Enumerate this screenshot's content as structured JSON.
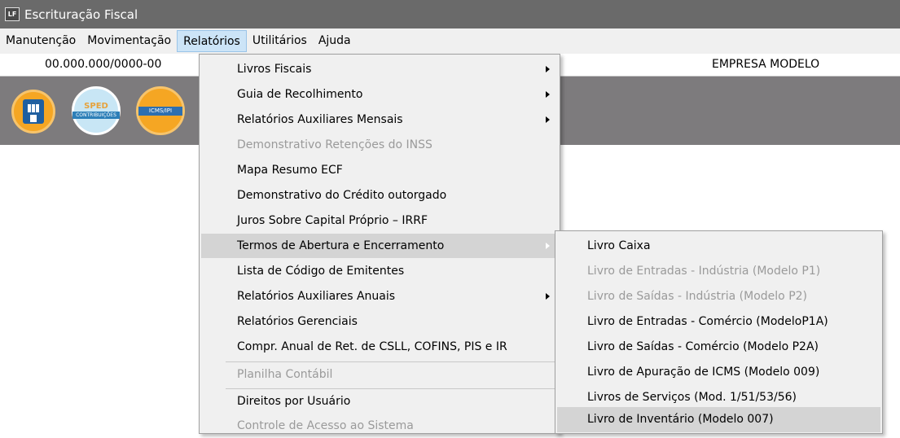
{
  "window": {
    "title": "Escrituração Fiscal",
    "icon_label": "LF"
  },
  "menubar": [
    "Manutenção",
    "Movimentação",
    "Relatórios",
    "Utilitários",
    "Ajuda"
  ],
  "info": {
    "cnpj": "00.000.000/0000-00",
    "company": "EMPRESA MODELO"
  },
  "toolbar": {
    "sped_top": "SPED",
    "sped_band": "CONTRIBUIÇÕES",
    "icms_band": "ICMS/IPI"
  },
  "relatorios_menu": [
    {
      "label": "Livros Fiscais",
      "submenu": true,
      "enabled": true
    },
    {
      "label": "Guia de Recolhimento",
      "submenu": true,
      "enabled": true
    },
    {
      "label": "Relatórios Auxiliares Mensais",
      "submenu": true,
      "enabled": true
    },
    {
      "label": "Demonstrativo Retenções do INSS",
      "submenu": false,
      "enabled": false
    },
    {
      "label": "Mapa Resumo ECF",
      "submenu": false,
      "enabled": true
    },
    {
      "label": "Demonstrativo do Crédito outorgado",
      "submenu": false,
      "enabled": true
    },
    {
      "label": "Juros Sobre Capital Próprio – IRRF",
      "submenu": false,
      "enabled": true
    },
    {
      "label": "Termos de Abertura e Encerramento",
      "submenu": true,
      "enabled": true,
      "highlighted": true
    },
    {
      "label": "Lista de Código de Emitentes",
      "submenu": false,
      "enabled": true
    },
    {
      "label": "Relatórios Auxiliares Anuais",
      "submenu": true,
      "enabled": true
    },
    {
      "label": "Relatórios Gerenciais",
      "submenu": false,
      "enabled": true
    },
    {
      "label": "Compr. Anual de Ret. de CSLL, COFINS,  PIS e IR",
      "submenu": false,
      "enabled": true
    },
    {
      "label": "Planilha Contábil",
      "submenu": false,
      "enabled": false
    },
    {
      "label": "Direitos por Usuário",
      "submenu": false,
      "enabled": true
    },
    {
      "label": "Controle de Acesso ao Sistema",
      "submenu": false,
      "enabled": false
    }
  ],
  "termos_submenu": [
    {
      "label": "Livro Caixa",
      "enabled": true
    },
    {
      "label": "Livro de Entradas - Indústria (Modelo P1)",
      "enabled": false
    },
    {
      "label": "Livro de Saídas - Indústria (Modelo P2)",
      "enabled": false
    },
    {
      "label": "Livro de Entradas - Comércio (ModeloP1A)",
      "enabled": true
    },
    {
      "label": "Livro de Saídas - Comércio (Modelo P2A)",
      "enabled": true
    },
    {
      "label": "Livro de Apuração de ICMS (Modelo 009)",
      "enabled": true
    },
    {
      "label": "Livros de Serviços (Mod. 1/51/53/56)",
      "enabled": true
    },
    {
      "label": "Livro de Inventário (Modelo 007)",
      "enabled": true,
      "highlighted": true
    }
  ]
}
